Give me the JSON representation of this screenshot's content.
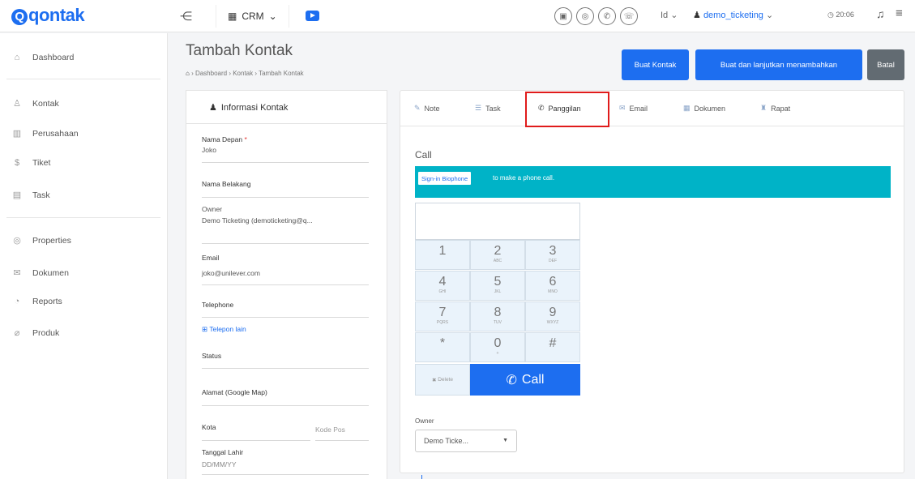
{
  "topbar": {
    "logo": "qontak",
    "logo_letter": "Q",
    "app_switch": "CRM",
    "lang": "Id",
    "user": "demo_ticketing",
    "clock": "20:06"
  },
  "sidebar": {
    "items": [
      {
        "label": "Dashboard",
        "icon": "home-icon"
      },
      {
        "label": "Kontak",
        "icon": "contacts-icon"
      },
      {
        "label": "Perusahaan",
        "icon": "building-icon"
      },
      {
        "label": "Tiket",
        "icon": "dollar-icon"
      },
      {
        "label": "Task",
        "icon": "calendar-icon"
      },
      {
        "label": "Properties",
        "icon": "properties-icon"
      },
      {
        "label": "Dokumen",
        "icon": "document-icon"
      },
      {
        "label": "Reports",
        "icon": "reports-icon"
      },
      {
        "label": "Produk",
        "icon": "tag-icon"
      }
    ]
  },
  "header": {
    "title": "Tambah Kontak",
    "breadcrumb": [
      "Dashboard",
      "Kontak",
      "Tambah Kontak"
    ],
    "btn_create": "Buat Kontak",
    "btn_create_continue": "Buat dan lanjutkan menambahkan",
    "btn_cancel": "Batal"
  },
  "info": {
    "title": "Informasi Kontak",
    "first_name_label": "Nama Depan",
    "first_name": "Joko",
    "last_name_label": "Nama Belakang",
    "owner_label": "Owner",
    "owner": "Demo Ticketing (demoticketing@q...",
    "email_label": "Email",
    "email": "joko@unilever.com",
    "telephone_label": "Telephone",
    "telephone_other": "Telepon lain",
    "status_label": "Status",
    "address_label": "Alamat (Google Map)",
    "city_label": "Kota",
    "postal_placeholder": "Kode Pos",
    "birthdate_label": "Tanggal Lahir",
    "birthdate_placeholder": "DD/MM/YY"
  },
  "activity": {
    "tabs": [
      {
        "label": "Note",
        "icon": "edit-icon"
      },
      {
        "label": "Task",
        "icon": "list-icon"
      },
      {
        "label": "Panggilan",
        "icon": "phone-icon"
      },
      {
        "label": "Email",
        "icon": "mail-icon"
      },
      {
        "label": "Dokumen",
        "icon": "file-icon"
      },
      {
        "label": "Rapat",
        "icon": "people-icon"
      }
    ],
    "active_tab": "Panggilan",
    "call_title": "Call",
    "signin_button": "Sign-in Biophone",
    "signin_text": "to make a phone call.",
    "keys": [
      {
        "digit": "1",
        "letters": ""
      },
      {
        "digit": "2",
        "letters": "ABC"
      },
      {
        "digit": "3",
        "letters": "DEF"
      },
      {
        "digit": "4",
        "letters": "GHI"
      },
      {
        "digit": "5",
        "letters": "JKL"
      },
      {
        "digit": "6",
        "letters": "MNO"
      },
      {
        "digit": "7",
        "letters": "PQRS"
      },
      {
        "digit": "8",
        "letters": "TUV"
      },
      {
        "digit": "9",
        "letters": "WXYZ"
      },
      {
        "digit": "*",
        "letters": ""
      },
      {
        "digit": "0",
        "letters": "+"
      },
      {
        "digit": "#",
        "letters": ""
      }
    ],
    "delete_label": "Delete",
    "call_label": "Call",
    "owner_label": "Owner",
    "owner_value": "Demo Ticke..."
  },
  "colors": {
    "accent": "#1d6ef0",
    "banner": "#00b3c7",
    "highlight": "#e01b1b"
  }
}
